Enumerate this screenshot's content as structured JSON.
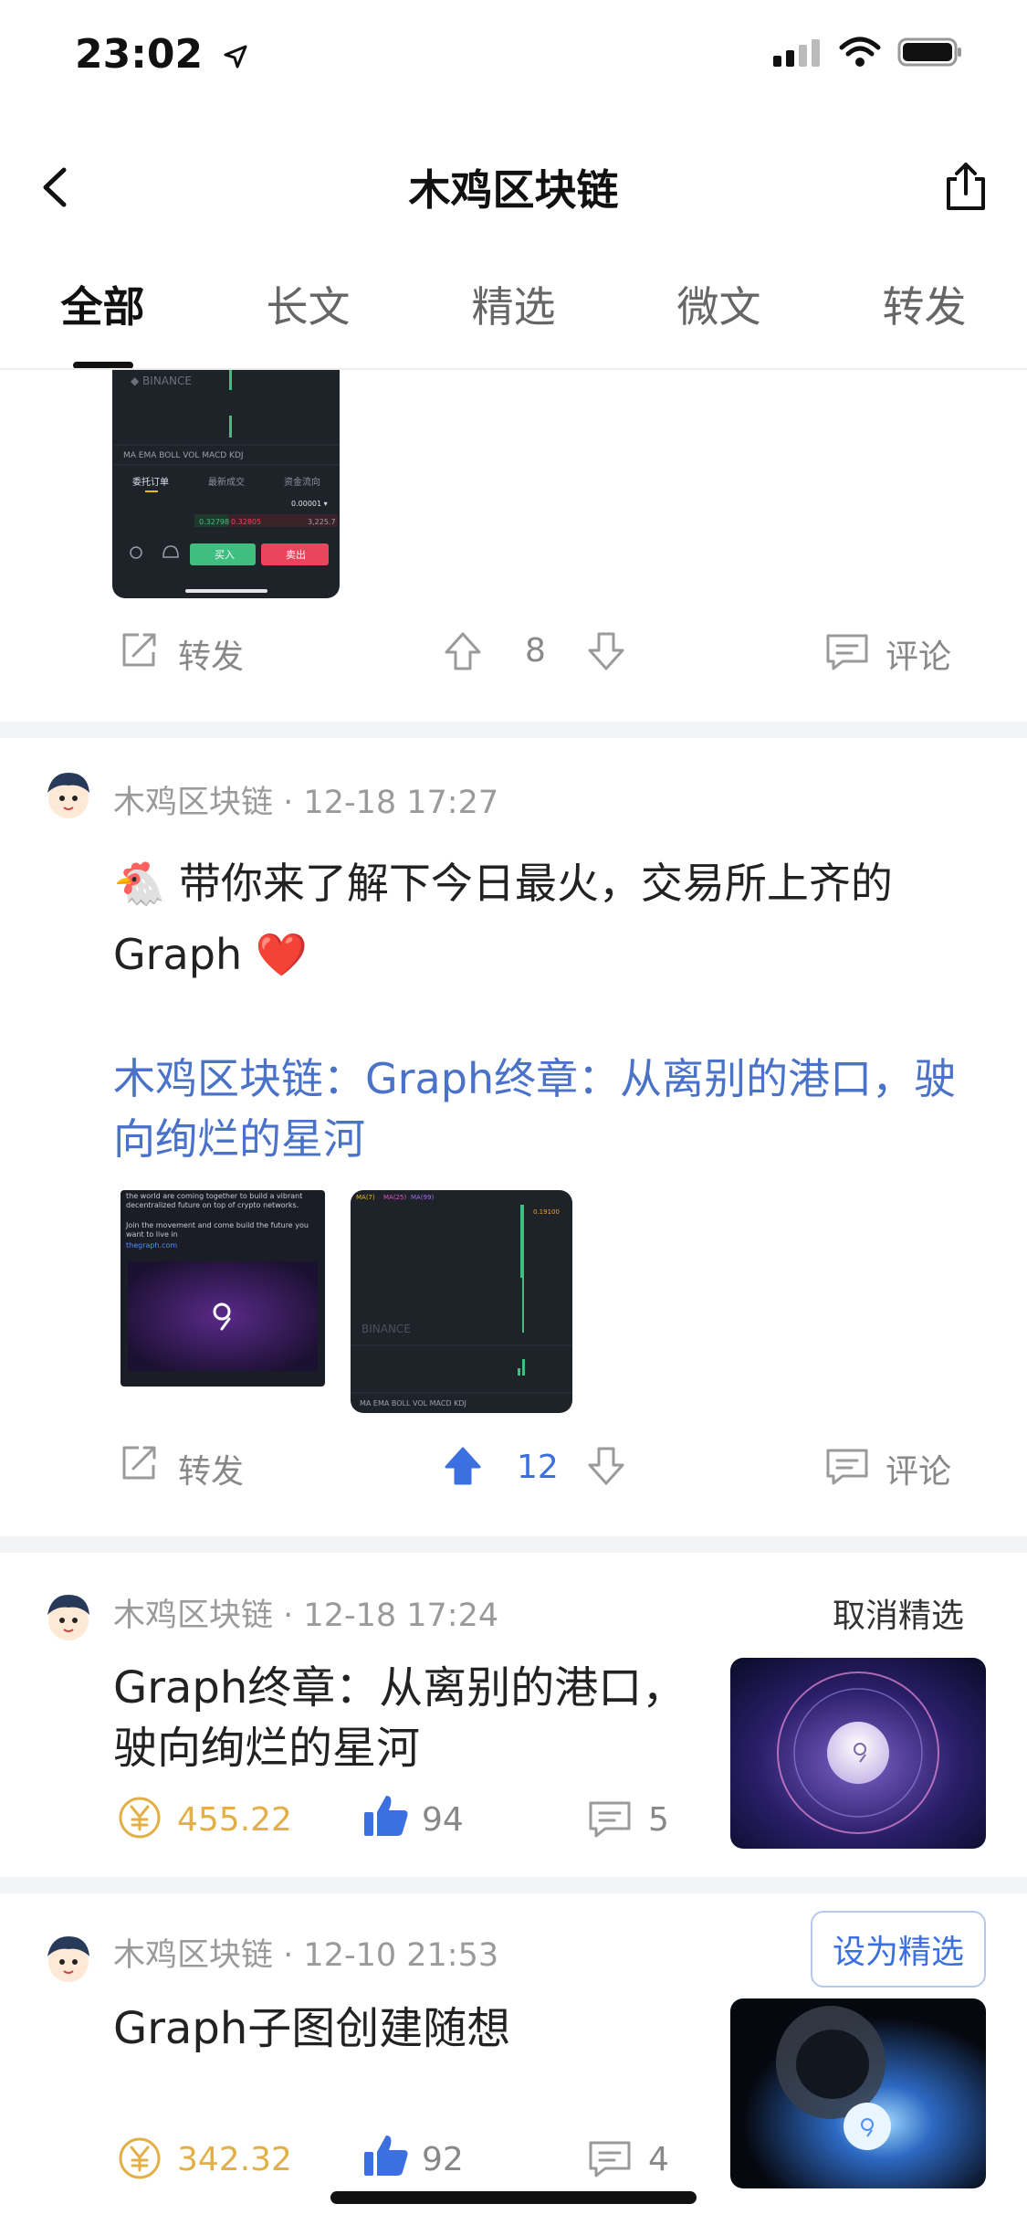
{
  "status_bar": {
    "time": "23:02"
  },
  "nav": {
    "title": "木鸡区块链"
  },
  "tabs": [
    "全部",
    "长文",
    "精选",
    "微文",
    "转发"
  ],
  "post1_actions": {
    "repost": "转发",
    "votes": "8",
    "comment": "评论"
  },
  "post1_chart": {
    "brand": "BINANCE",
    "tabs": [
      "MA",
      "EMA",
      "BOLL",
      "VOL",
      "MACD",
      "KDJ"
    ],
    "order_tabs": [
      "委托订单",
      "最新成交",
      "资金流向"
    ],
    "buy": "买入",
    "sell": "卖出"
  },
  "post2": {
    "author": "木鸡区块链",
    "date": "12-18 17:27",
    "text_line1": "🐔 带你来了解下今日最火，交易所上齐的",
    "text_line2": "Graph ❤️",
    "link_line1": "木鸡区块链：Graph终章：从离别的港口，驶",
    "link_line2": "向绚烂的星河",
    "actions": {
      "repost": "转发",
      "votes": "12",
      "comment": "评论"
    },
    "image1_text": "the world are coming together to build a vibrant decentralized future on top of crypto networks.\nJoin the movement and come build the future you want to live in",
    "image1_link": "thegraph.com",
    "image2_brand": "BINANCE"
  },
  "post3": {
    "author": "木鸡区块链",
    "date": "12-18 17:24",
    "action": "取消精选",
    "title_line1": "Graph终章：从离别的港口，",
    "title_line2": "驶向绚烂的星河",
    "money": "455.22",
    "likes": "94",
    "comments": "5"
  },
  "post4": {
    "author": "木鸡区块链",
    "date": "12-10 21:53",
    "action": "设为精选",
    "title": "Graph子图创建随想",
    "money": "342.32",
    "likes": "92",
    "comments": "4"
  },
  "colors": {
    "accent": "#3c6fe0",
    "money": "#e2b046",
    "separator": "#f2f3f5"
  }
}
